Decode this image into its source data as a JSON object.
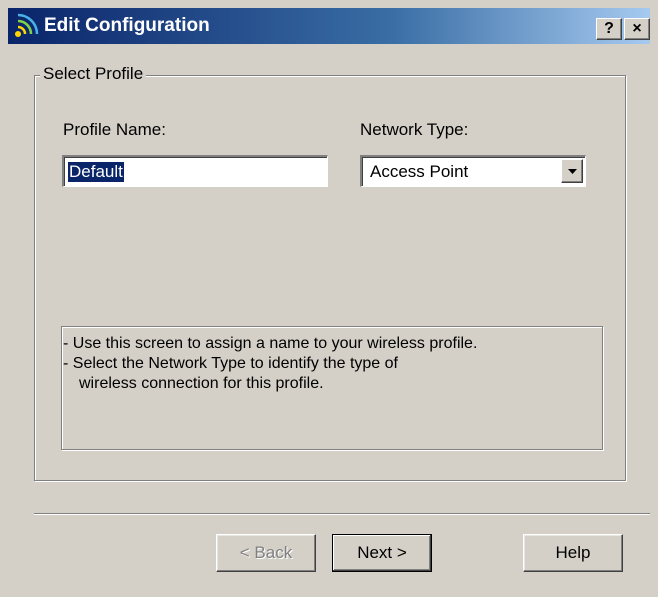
{
  "window": {
    "title": "Edit Configuration",
    "help_button": "?",
    "close_button": "×"
  },
  "group": {
    "legend": "Select Profile"
  },
  "profile": {
    "label": "Profile Name:",
    "value": "Default"
  },
  "network": {
    "label": "Network Type:",
    "selected": "Access Point"
  },
  "info": {
    "line1": "- Use this screen to assign a name to your wireless profile.",
    "line2": "- Select the Network Type to identify the type of",
    "line3": "wireless connection for this profile."
  },
  "buttons": {
    "back": "< Back",
    "next": "Next >",
    "help": "Help"
  },
  "colors": {
    "dialog_bg": "#d4d0c8",
    "titlebar_start": "#0a246a",
    "titlebar_end": "#a6caf0",
    "selection": "#0a246a"
  },
  "icons": {
    "title_icon": "wireless-signal-icon",
    "dropdown_arrow": "chevron-down-icon"
  }
}
